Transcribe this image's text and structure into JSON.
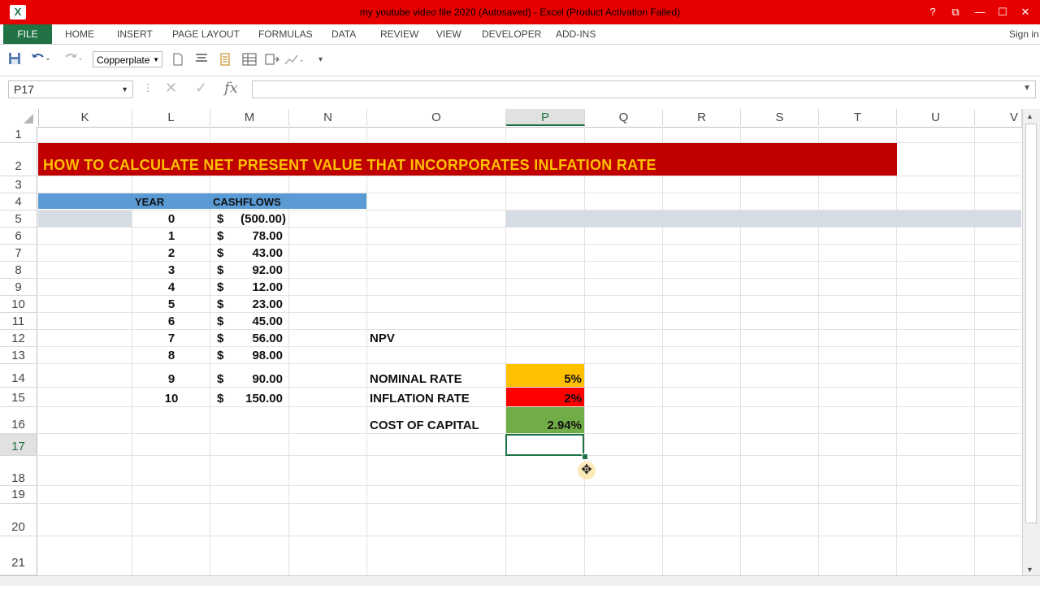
{
  "window": {
    "title": "my youtube video file 2020 (Autosaved) -  Excel (Product Activation Failed)",
    "app_icon": "X",
    "help": "?",
    "ribbon_display": "⧉",
    "minimize": "—",
    "maximize": "☐",
    "close": "✕",
    "sign_in": "Sign in"
  },
  "ribbon": {
    "tabs": [
      "FILE",
      "HOME",
      "INSERT",
      "PAGE LAYOUT",
      "FORMULAS",
      "DATA",
      "REVIEW",
      "VIEW",
      "DEVELOPER",
      "ADD-INS"
    ]
  },
  "qat": {
    "font": "Copperplate"
  },
  "formula_bar": {
    "name_box": "P17",
    "fx": "fx",
    "cancel": "✕",
    "enter": "✓"
  },
  "grid": {
    "columns": [
      "K",
      "L",
      "M",
      "N",
      "O",
      "P",
      "Q",
      "R",
      "S",
      "T",
      "U",
      "V"
    ],
    "selected_column": "P",
    "rows": [
      "1",
      "2",
      "3",
      "4",
      "5",
      "6",
      "7",
      "8",
      "9",
      "10",
      "11",
      "12",
      "13",
      "14",
      "15",
      "16",
      "17",
      "18",
      "19",
      "20",
      "21"
    ],
    "selected_row": "17"
  },
  "sheet": {
    "banner": "HOW TO CALCULATE NET PRESENT VALUE THAT INCORPORATES INLFATION RATE",
    "header_year": "YEAR",
    "header_cashflows": "CASHFLOWS",
    "years": [
      "0",
      "1",
      "2",
      "3",
      "4",
      "5",
      "6",
      "7",
      "8",
      "9",
      "10"
    ],
    "currency": "$",
    "cashflows": [
      "(500.00)",
      "78.00",
      "43.00",
      "92.00",
      "12.00",
      "23.00",
      "45.00",
      "56.00",
      "98.00",
      "90.00",
      "150.00"
    ],
    "npv_label": "NPV",
    "nominal_label": "NOMINAL RATE",
    "nominal_value": "5%",
    "inflation_label": "INFLATION RATE",
    "inflation_value": "2%",
    "coc_label": "COST OF CAPITAL",
    "coc_value": "2.94%"
  },
  "colors": {
    "banner_bg": "#c00000",
    "banner_text": "#ffc000",
    "excel_green": "#217346",
    "title_bar": "#e60000"
  }
}
